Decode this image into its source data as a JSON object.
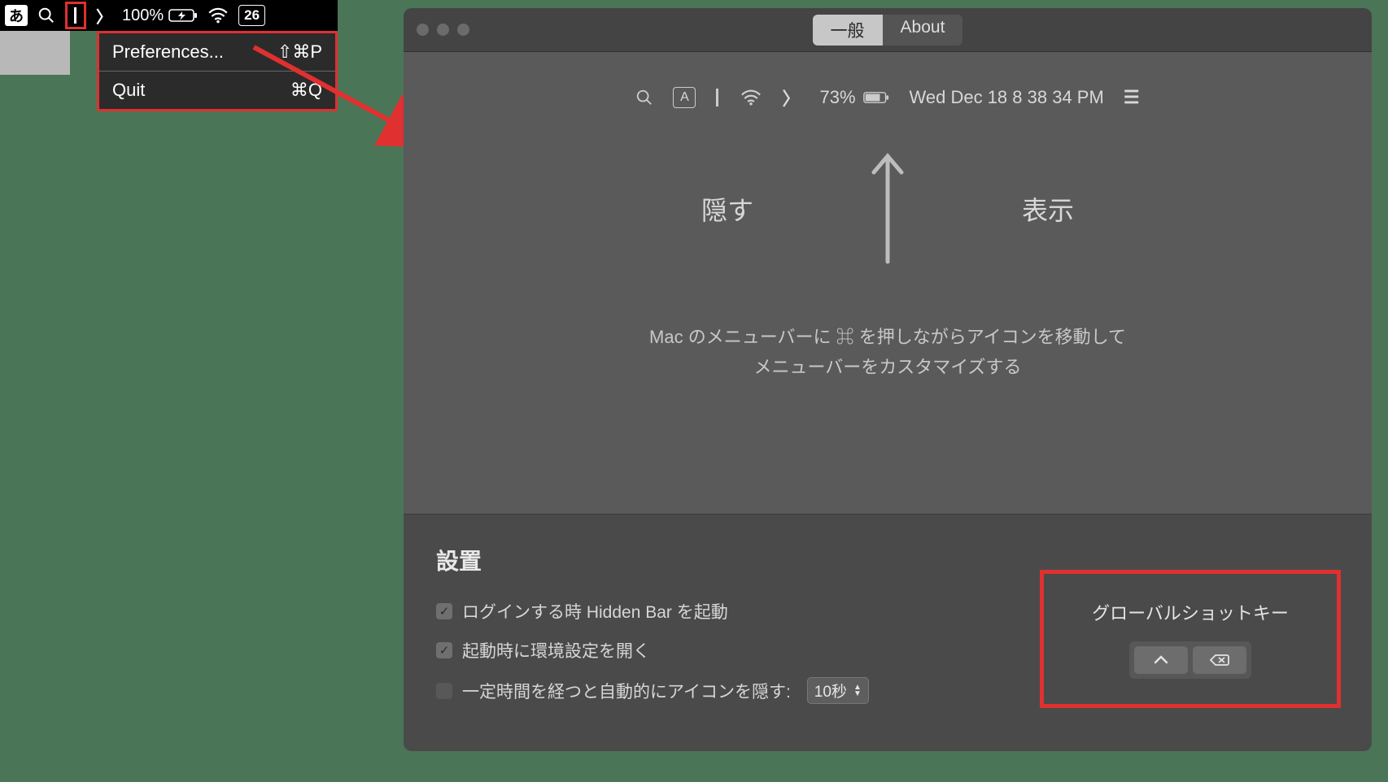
{
  "menubar": {
    "ime_label": "あ",
    "battery_percent": "100%",
    "date_box": "26",
    "dropdown": {
      "items": [
        {
          "label": "Preferences...",
          "shortcut": "⇧⌘P"
        },
        {
          "label": "Quit",
          "shortcut": "⌘Q"
        }
      ]
    }
  },
  "window": {
    "tabs": {
      "general": "一般",
      "about": "About"
    },
    "preview": {
      "ime_label": "A",
      "battery_percent": "73%",
      "datetime": "Wed Dec 18  8 38 34 PM"
    },
    "labels": {
      "hide": "隠す",
      "show": "表示"
    },
    "instruction_line1_prefix": "Mac のメニューバーに ",
    "instruction_cmd": "⌘",
    "instruction_line1_suffix": " を押しながらアイコンを移動して",
    "instruction_line2": "メニューバーをカスタマイズする",
    "settings_header": "設置",
    "checkbox1": "ログインする時 Hidden Bar を起動",
    "checkbox2": "起動時に環境設定を開く",
    "checkbox3": "一定時間を経つと自動的にアイコンを隠す:",
    "autohide_value": "10秒",
    "shortcut_title": "グローバルショットキー"
  }
}
